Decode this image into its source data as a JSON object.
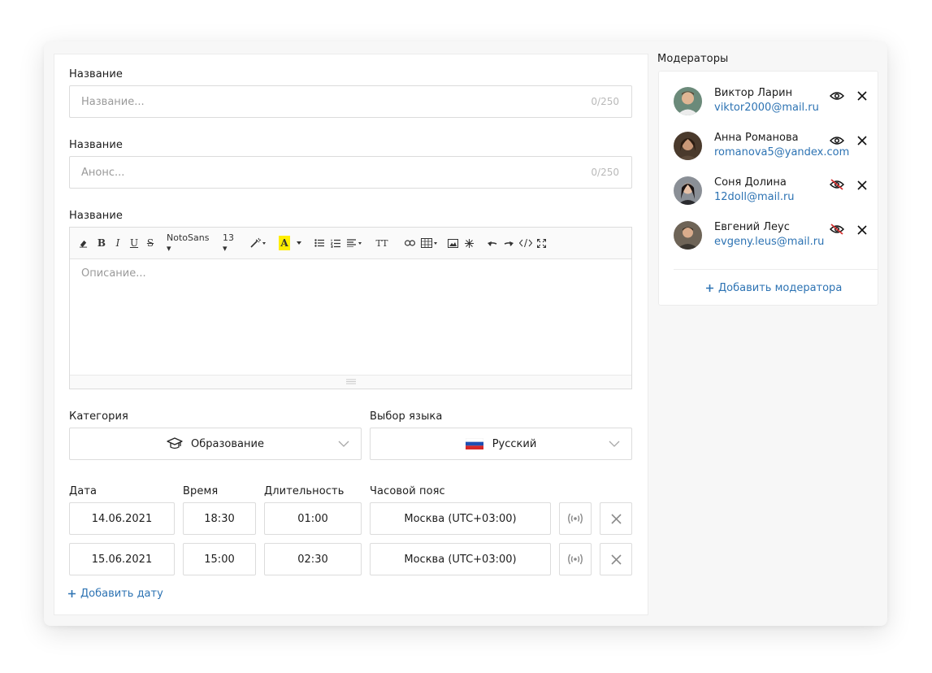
{
  "form": {
    "title_label": "Название",
    "title_placeholder": "Название...",
    "title_counter": "0/250",
    "announce_label": "Название",
    "announce_placeholder": "Анонс...",
    "announce_counter": "0/250",
    "description_label": "Название",
    "description_placeholder": "Описание...",
    "toolbar": {
      "bold": "B",
      "italic": "I",
      "underline": "U",
      "strike": "S",
      "font": "NotoSans ▾",
      "size": "13 ▾",
      "color_letter": "A",
      "text_size": "TT"
    }
  },
  "category": {
    "label": "Категория",
    "value": "Образование",
    "icon": "graduation-cap-icon"
  },
  "language": {
    "label": "Выбор языка",
    "value": "Русский",
    "icon": "russia-flag-icon"
  },
  "schedule": {
    "headers": {
      "date": "Дата",
      "time": "Время",
      "duration": "Длительность",
      "timezone": "Часовой пояс"
    },
    "rows": [
      {
        "date": "14.06.2021",
        "time": "18:30",
        "duration": "01:00",
        "timezone": "Москва (UTC+03:00)"
      },
      {
        "date": "15.06.2021",
        "time": "15:00",
        "duration": "02:30",
        "timezone": "Москва (UTC+03:00)"
      }
    ],
    "add_date_label": "Добавить дату"
  },
  "moderators": {
    "title": "Модераторы",
    "items": [
      {
        "name": "Виктор Ларин",
        "email": "viktor2000@mail.ru",
        "visible": true
      },
      {
        "name": "Анна Романова",
        "email": "romanova5@yandex.com",
        "visible": true
      },
      {
        "name": "Соня Долина",
        "email": "12doll@mail.ru",
        "visible": false
      },
      {
        "name": "Евгений Леус",
        "email": "evgeny.leus@mail.ru",
        "visible": false
      }
    ],
    "add_label": "Добавить модератора"
  },
  "colors": {
    "link": "#2d73b3",
    "hidden_eye": "#d32f2f",
    "highlight": "#ffee00"
  }
}
